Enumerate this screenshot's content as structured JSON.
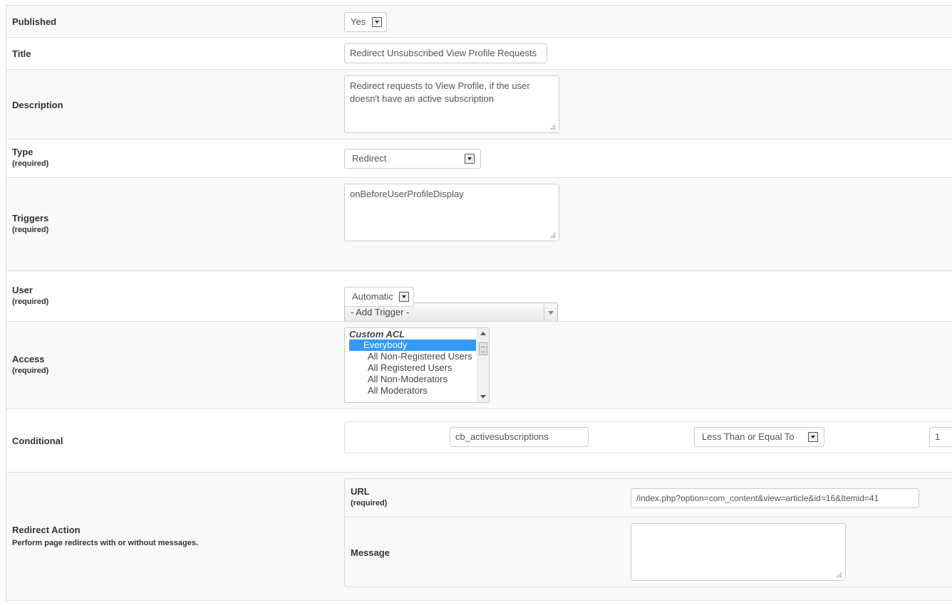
{
  "published": {
    "label": "Published",
    "value": "Yes"
  },
  "title_field": {
    "label": "Title",
    "value": "Redirect Unsubscribed View Profile Requests"
  },
  "description": {
    "label": "Description",
    "value": "Redirect requests to View Profile, if the user doesn't have an active subscription"
  },
  "type": {
    "label": "Type",
    "required": "(required)",
    "value": "Redirect"
  },
  "triggers": {
    "label": "Triggers",
    "required": "(required)",
    "value": "onBeforeUserProfileDisplay",
    "add_trigger": "- Add Trigger -"
  },
  "user": {
    "label": "User",
    "required": "(required)",
    "value": "Automatic"
  },
  "access": {
    "label": "Access",
    "required": "(required)",
    "group": "Custom ACL",
    "options": [
      "Everybody",
      "All Non-Registered Users",
      "All Registered Users",
      "All Non-Moderators",
      "All Moderators"
    ],
    "selected": "Everybody"
  },
  "conditional": {
    "label": "Conditional",
    "field": "cb_activesubscriptions",
    "operator": "Less Than or Equal To",
    "value": "1"
  },
  "redirect_action": {
    "label": "Redirect Action",
    "description": "Perform page redirects with or without messages.",
    "url_label": "URL",
    "url_required": "(required)",
    "url_value": "/index.php?option=com_content&view=article&id=16&Itemid=41",
    "message_label": "Message",
    "message_value": ""
  },
  "colors": {
    "selected_option": "#3399ff",
    "row_alt": "#f9f9f9",
    "border": "#dddddd"
  }
}
